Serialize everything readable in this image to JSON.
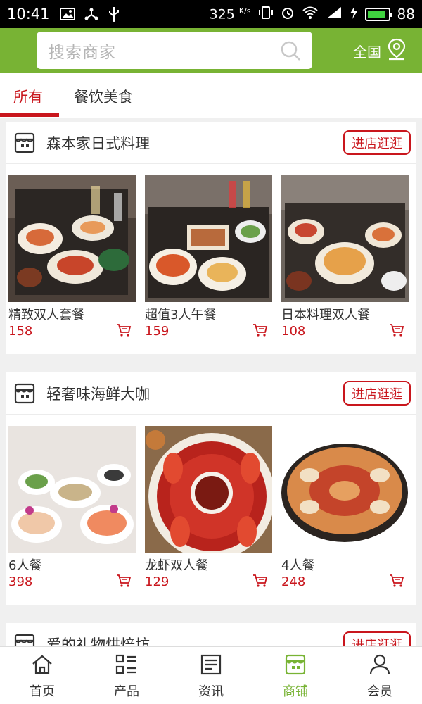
{
  "status_bar": {
    "time": "10:41",
    "net_speed": "325",
    "net_unit": "K/s",
    "battery_level": "88",
    "battery_fill_fraction": 0.88
  },
  "header": {
    "search_placeholder": "搜索商家",
    "region": "全国",
    "accent_color": "#78b334"
  },
  "categories": [
    {
      "label": "所有",
      "active": true
    },
    {
      "label": "餐饮美食",
      "active": false
    }
  ],
  "shops": [
    {
      "name": "森本家日式料理",
      "visit_label": "进店逛逛",
      "products": [
        {
          "name": "精致双人套餐",
          "price": "158"
        },
        {
          "name": "超值3人午餐",
          "price": "159"
        },
        {
          "name": "日本料理双人餐",
          "price": "108"
        }
      ]
    },
    {
      "name": "轻奢味海鲜大咖",
      "visit_label": "进店逛逛",
      "products": [
        {
          "name": "6人餐",
          "price": "398"
        },
        {
          "name": "龙虾双人餐",
          "price": "129"
        },
        {
          "name": "4人餐",
          "price": "248"
        }
      ]
    },
    {
      "name": "爱的礼物烘焙坊",
      "visit_label": "进店逛逛",
      "products": []
    }
  ],
  "bottom_nav": [
    {
      "label": "首页",
      "icon": "home-icon",
      "active": false
    },
    {
      "label": "产品",
      "icon": "grid-list-icon",
      "active": false
    },
    {
      "label": "资讯",
      "icon": "news-icon",
      "active": false
    },
    {
      "label": "商铺",
      "icon": "store-icon",
      "active": true
    },
    {
      "label": "会员",
      "icon": "user-icon",
      "active": false
    }
  ],
  "colors": {
    "accent_red": "#c9161d",
    "accent_green": "#78b334"
  }
}
